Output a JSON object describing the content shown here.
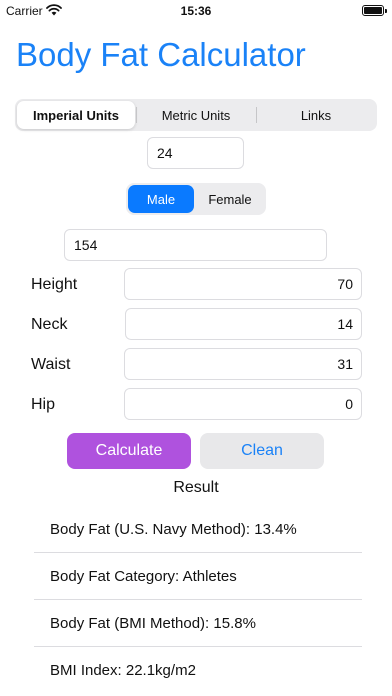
{
  "status": {
    "carrier": "Carrier",
    "time": "15:36"
  },
  "header": {
    "title": "Body Fat Calculator"
  },
  "tabs": [
    {
      "label": "Imperial Units",
      "selected": true
    },
    {
      "label": "Metric Units",
      "selected": false
    },
    {
      "label": "Links",
      "selected": false
    }
  ],
  "form": {
    "age_value": "24",
    "gender": {
      "options": [
        "Male",
        "Female"
      ],
      "selected": "Male"
    },
    "weight_value": "154",
    "fields": [
      {
        "label": "Height",
        "value": "70"
      },
      {
        "label": "Neck",
        "value": "14"
      },
      {
        "label": "Waist",
        "value": "31"
      },
      {
        "label": "Hip",
        "value": "0"
      }
    ]
  },
  "actions": {
    "calculate_label": "Calculate",
    "clean_label": "Clean"
  },
  "result": {
    "heading": "Result",
    "items": [
      "Body Fat (U.S. Navy Method): 13.4%",
      "Body Fat Category: Athletes",
      "Body Fat (BMI Method): 15.8%",
      "BMI Index: 22.1kg/m2"
    ]
  },
  "colors": {
    "accent_blue": "#1a82f7",
    "selected_blue": "#0a7aff",
    "calculate_purple": "#af52de"
  }
}
